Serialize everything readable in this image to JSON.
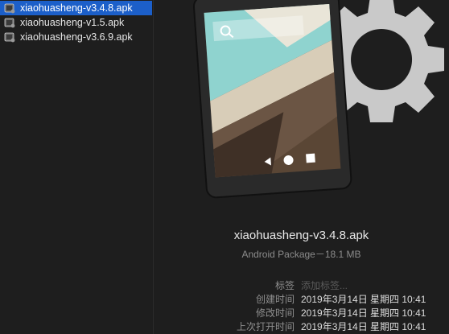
{
  "files": [
    {
      "name": "xiaohuasheng-v3.4.8.apk",
      "selected": true,
      "icon": "apk-file-icon"
    },
    {
      "name": "xiaohuasheng-v1.5.apk",
      "selected": false,
      "icon": "apk-file-icon"
    },
    {
      "name": "xiaohuasheng-v3.6.9.apk",
      "selected": false,
      "icon": "apk-file-icon"
    }
  ],
  "preview": {
    "title": "xiaohuasheng-v3.4.8.apk",
    "subtitle": "Android Package－18.1 MB",
    "tags_label": "标签",
    "tags_placeholder": "添加标签...",
    "created_label": "创建时间",
    "created_value": "2019年3月14日 星期四 10:41",
    "modified_label": "修改时间",
    "modified_value": "2019年3月14日 星期四 10:41",
    "last_opened_label": "上次打开时间",
    "last_opened_value": "2019年3月14日 星期四 10:41"
  },
  "colors": {
    "selection": "#1c5fc9",
    "background": "#1e1e1e"
  }
}
